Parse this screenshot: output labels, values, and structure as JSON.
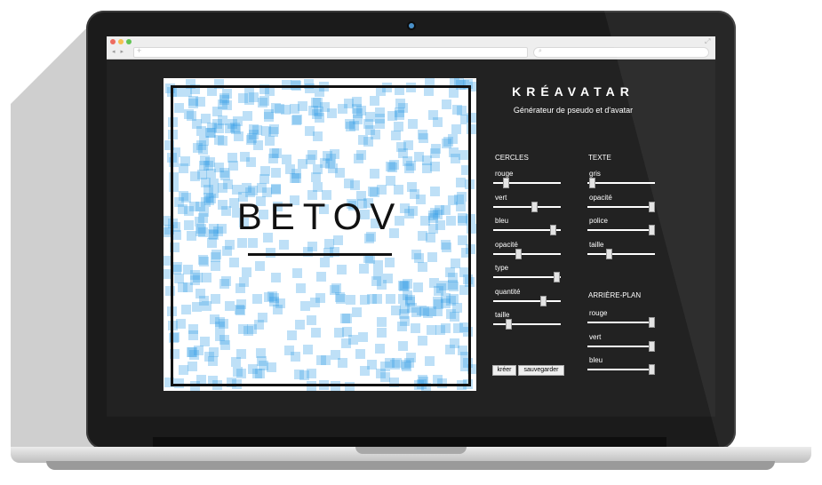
{
  "app": {
    "brand": "KRÉAVATAR",
    "subtitle": "Générateur de pseudo et d'avatar"
  },
  "avatar": {
    "pseudo": "BETOV",
    "square_color": "#34a0e6",
    "frame_color": "#111111"
  },
  "browser": {
    "nav_icons": "◂ ▸",
    "url_plus": "+",
    "search_icon": "⌕",
    "expand_icon": "⤢"
  },
  "sections": {
    "cercles": {
      "title": "CERCLES",
      "sliders": [
        {
          "label": "rouge",
          "value": 0.15
        },
        {
          "label": "vert",
          "value": 0.62
        },
        {
          "label": "bleu",
          "value": 0.92
        },
        {
          "label": "opacité",
          "value": 0.35
        },
        {
          "label": "type",
          "value": 0.97
        },
        {
          "label": "quantité",
          "value": 0.75
        },
        {
          "label": "taille",
          "value": 0.2
        }
      ]
    },
    "texte": {
      "title": "TEXTE",
      "sliders": [
        {
          "label": "gris",
          "value": 0.03
        },
        {
          "label": "opacité",
          "value": 0.98
        },
        {
          "label": "police",
          "value": 0.98
        },
        {
          "label": "taille",
          "value": 0.3
        }
      ]
    },
    "arriere_plan": {
      "title": "ARRIÈRE-PLAN",
      "sliders": [
        {
          "label": "rouge",
          "value": 0.98
        },
        {
          "label": "vert",
          "value": 0.98
        },
        {
          "label": "bleu",
          "value": 0.98
        }
      ]
    }
  },
  "buttons": {
    "create": "kréer",
    "save": "sauvegarder"
  }
}
